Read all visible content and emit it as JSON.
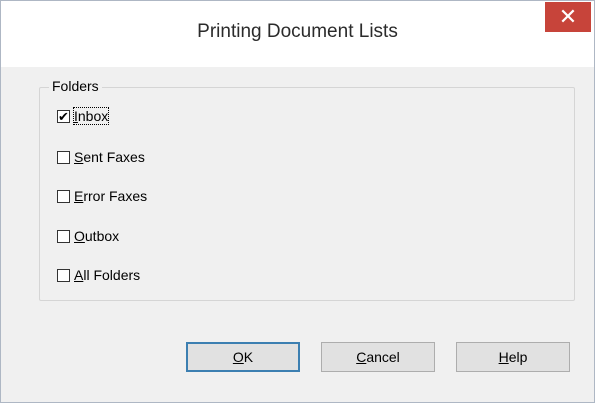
{
  "window": {
    "title": "Printing Document Lists",
    "close_glyph": "✕"
  },
  "group": {
    "legend": "Folders",
    "items": [
      {
        "mnemonic": "I",
        "rest": "nbox",
        "checked": true
      },
      {
        "mnemonic": "S",
        "rest": "ent Faxes",
        "checked": false
      },
      {
        "mnemonic": "E",
        "rest": "rror Faxes",
        "checked": false
      },
      {
        "mnemonic": "O",
        "rest": "utbox",
        "checked": false
      },
      {
        "mnemonic": "A",
        "rest": "ll Folders",
        "checked": false
      }
    ]
  },
  "buttons": {
    "ok": {
      "mnemonic": "O",
      "rest": "K"
    },
    "cancel": {
      "mnemonic": "C",
      "rest": "ancel"
    },
    "help": {
      "mnemonic": "H",
      "rest": "elp"
    }
  },
  "check_glyph": "✔",
  "colors": {
    "close_bg": "#c7443a",
    "default_button_border": "#3c7fb1"
  }
}
